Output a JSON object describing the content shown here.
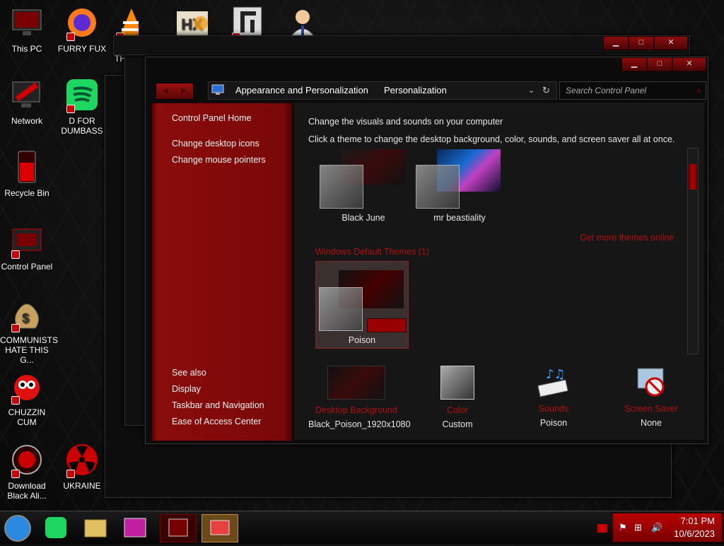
{
  "desktop_icons": [
    {
      "label": "This PC",
      "icon": "monitor-icon"
    },
    {
      "label": "FURRY FUX",
      "icon": "firefox-icon"
    },
    {
      "label": "DO TH",
      "icon": "vlc-icon"
    },
    {
      "label": "",
      "icon": "hxd-icon"
    },
    {
      "label": "",
      "icon": "app-icon"
    },
    {
      "label": "",
      "icon": "user-icon"
    },
    {
      "label": "Network",
      "icon": "network-icon"
    },
    {
      "label": "D FOR DUMBASS",
      "icon": "spotify-icon"
    },
    {
      "label": "Recycle Bin",
      "icon": "recycle-bin-icon"
    },
    {
      "label": "Control Panel",
      "icon": "control-panel-icon"
    },
    {
      "label": "COMMUNISTS HATE THIS G...",
      "icon": "money-bag-icon"
    },
    {
      "label": "CHUZZIN CUM",
      "icon": "chuzzle-icon"
    },
    {
      "label": "Download Black Ali...",
      "icon": "download-icon"
    },
    {
      "label": "UKRAINE",
      "icon": "radiation-icon"
    }
  ],
  "window": {
    "address": {
      "item1": "Appearance and Personalization",
      "item2": "Personalization"
    },
    "search_placeholder": "Search Control Panel",
    "controls": {
      "minimize": "▁",
      "maximize": "□",
      "close": "✕"
    }
  },
  "left_pane": {
    "home": "Control Panel Home",
    "links": [
      "Change desktop icons",
      "Change mouse pointers"
    ],
    "see_also_title": "See also",
    "see_also": [
      "Display",
      "Taskbar and Navigation",
      "Ease of Access Center"
    ]
  },
  "content": {
    "heading": "Change the visuals and sounds on your computer",
    "subheading": "Click a theme to change the desktop background, color, sounds, and screen saver all at once.",
    "my_themes": [
      "Black June",
      "mr beastiality"
    ],
    "more_online": "Get more themes online",
    "default_group": "Windows Default Themes (1)",
    "default_themes": [
      "Poison"
    ],
    "settings": [
      {
        "title": "Desktop Background",
        "value": "Black_Poison_1920x1080",
        "icon": "desktop-background-icon"
      },
      {
        "title": "Color",
        "value": "Custom",
        "icon": "color-icon"
      },
      {
        "title": "Sounds",
        "value": "Poison",
        "icon": "sounds-icon"
      },
      {
        "title": "Screen Saver",
        "value": "None",
        "icon": "screen-saver-icon"
      }
    ]
  },
  "taskbar": {
    "time": "7:01 PM",
    "date": "10/6/2023"
  },
  "colors": {
    "accent": "#8a0c0c",
    "accent_bright": "#cc1111",
    "background": "#0b0b0b"
  }
}
